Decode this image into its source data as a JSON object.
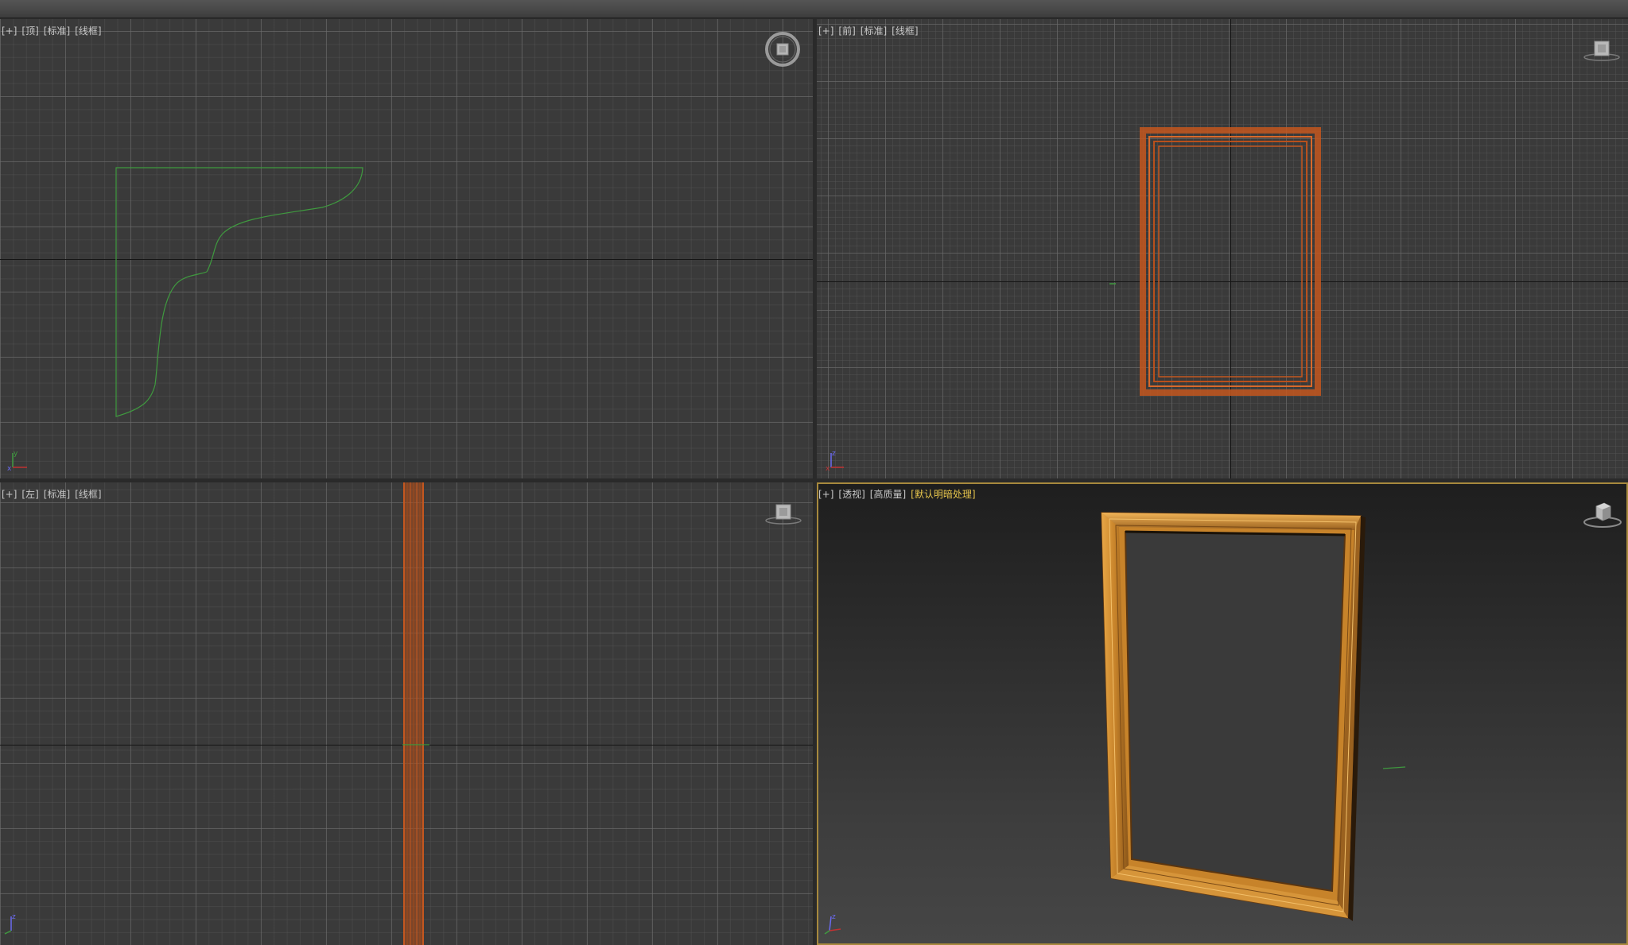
{
  "viewports": {
    "top": {
      "labels": [
        "[+]",
        "[顶]",
        "[标准]",
        "[线框]"
      ]
    },
    "front": {
      "labels": [
        "[+]",
        "[前]",
        "[标准]",
        "[线框]"
      ]
    },
    "left": {
      "labels": [
        "[+]",
        "[左]",
        "[标准]",
        "[线框]"
      ]
    },
    "perspective": {
      "labels": [
        "[+]",
        "[透视]",
        "[高质量]",
        "[默认明暗处理]"
      ]
    }
  },
  "axis_letters": {
    "x": "x",
    "y": "y",
    "z": "z"
  },
  "colors": {
    "grid_bg": "#3a3a3a",
    "spline_green": "#3f9a3f",
    "frame_orange": "#c4571f",
    "frame_gold": "#d18e2f",
    "active_border": "#a7893d",
    "highlight_label": "#e7c54c"
  },
  "icons": {
    "top_viewcube": "viewcube-top-icon",
    "front_viewcube": "viewcube-front-icon",
    "left_viewcube": "viewcube-left-icon",
    "persp_viewcube": "viewcube-perspective-icon"
  }
}
